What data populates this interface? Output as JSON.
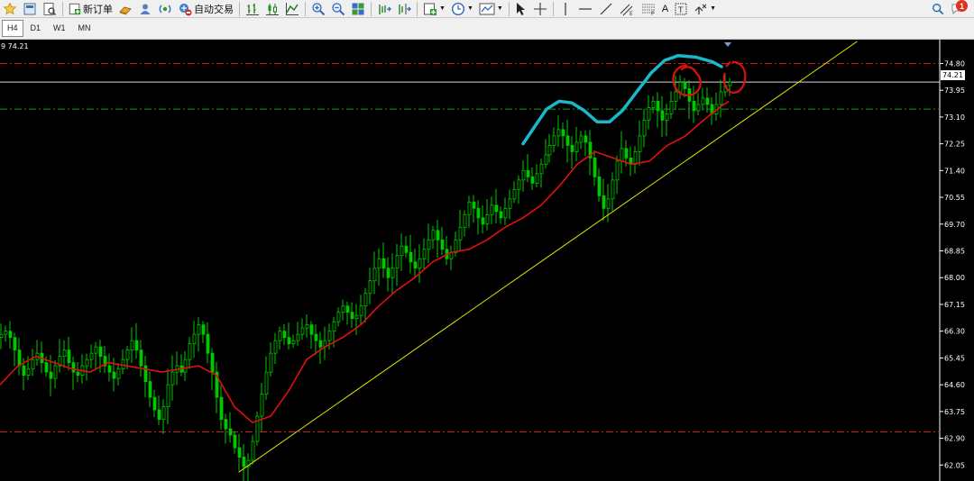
{
  "toolbar": {
    "new_order_label": "新订单",
    "auto_trade_label": "自动交易",
    "text_tool_label": "A",
    "notification_count": "1"
  },
  "timeframes": [
    {
      "label": "H4",
      "active": true
    },
    {
      "label": "D1",
      "active": false
    },
    {
      "label": "W1",
      "active": false
    },
    {
      "label": "MN",
      "active": false
    }
  ],
  "chart": {
    "info_text": "9 74.21",
    "current_price": "74.21",
    "colors": {
      "up_candle": "#00c800",
      "ma_line": "#e01010",
      "trendline": "#e6e600",
      "resistance": "#cc2020",
      "support": "#10a010",
      "annotation_curve": "#1ab8c8",
      "annotation_circles": "#dd1010"
    }
  },
  "chart_data": {
    "type": "candlestick",
    "y_ticks": [
      "74.80",
      "73.95",
      "73.10",
      "72.25",
      "71.40",
      "70.55",
      "69.70",
      "68.85",
      "68.00",
      "67.15",
      "66.30",
      "65.45",
      "64.60",
      "63.75",
      "62.90",
      "62.05"
    ],
    "ylim": [
      61.6,
      75.5
    ],
    "current_price": 74.21,
    "horizontal_levels": [
      {
        "price": 74.8,
        "style": "dash-dot",
        "color": "red"
      },
      {
        "price": 73.35,
        "style": "dash-dot",
        "color": "green"
      },
      {
        "price": 63.1,
        "style": "dash-dot",
        "color": "red"
      }
    ],
    "trendline": {
      "start": {
        "bar": 0.245,
        "price": 61.82
      },
      "end": {
        "bar": 0.88,
        "price": 75.5
      }
    },
    "closes": [
      66.2,
      66.3,
      66.1,
      65.7,
      65.2,
      64.9,
      65.1,
      65.4,
      65.6,
      65.3,
      65.0,
      64.8,
      65.2,
      65.5,
      65.7,
      65.3,
      65.0,
      64.9,
      65.2,
      65.4,
      65.6,
      65.8,
      65.5,
      65.2,
      65.0,
      64.8,
      65.1,
      65.4,
      65.7,
      66.0,
      65.7,
      65.2,
      64.7,
      64.2,
      63.8,
      63.5,
      63.9,
      64.6,
      65.0,
      65.2,
      65.0,
      65.4,
      65.9,
      66.2,
      66.5,
      66.2,
      65.6,
      65.0,
      64.2,
      63.5,
      63.2,
      63.0,
      62.6,
      62.3,
      62.0,
      62.2,
      62.8,
      63.6,
      64.3,
      65.0,
      65.6,
      66.0,
      66.3,
      66.1,
      65.9,
      66.0,
      66.2,
      66.4,
      66.5,
      66.2,
      66.0,
      65.8,
      66.0,
      66.3,
      66.6,
      66.9,
      67.1,
      66.9,
      66.7,
      66.8,
      67.1,
      67.5,
      67.9,
      68.3,
      68.6,
      68.3,
      68.0,
      68.3,
      68.7,
      69.0,
      68.8,
      68.5,
      68.3,
      68.6,
      68.9,
      69.2,
      69.5,
      69.2,
      68.9,
      68.6,
      68.8,
      69.2,
      69.6,
      70.0,
      70.4,
      70.2,
      69.9,
      69.7,
      70.0,
      70.3,
      70.1,
      69.9,
      70.2,
      70.5,
      70.8,
      71.1,
      71.4,
      71.2,
      71.0,
      71.3,
      71.6,
      71.9,
      72.2,
      72.5,
      72.7,
      72.5,
      72.2,
      72.0,
      72.3,
      72.5,
      72.3,
      71.8,
      71.2,
      70.6,
      70.2,
      70.5,
      71.1,
      71.7,
      72.1,
      71.8,
      71.6,
      72.0,
      72.5,
      73.0,
      73.4,
      73.6,
      73.3,
      73.0,
      73.2,
      73.6,
      73.9,
      74.2,
      74.0,
      73.6,
      73.3,
      73.5,
      73.7,
      73.5,
      73.2,
      73.5,
      73.9,
      74.1,
      74.21
    ],
    "ma_points": [
      [
        0,
        64.6
      ],
      [
        20,
        65.2
      ],
      [
        40,
        65.5
      ],
      [
        60,
        65.3
      ],
      [
        80,
        65.1
      ],
      [
        100,
        65.0
      ],
      [
        120,
        65.3
      ],
      [
        140,
        65.2
      ],
      [
        160,
        65.1
      ],
      [
        180,
        65.0
      ],
      [
        200,
        65.1
      ],
      [
        220,
        65.2
      ],
      [
        240,
        64.9
      ],
      [
        260,
        63.9
      ],
      [
        280,
        63.4
      ],
      [
        300,
        63.6
      ],
      [
        320,
        64.4
      ],
      [
        340,
        65.4
      ],
      [
        360,
        65.8
      ],
      [
        380,
        66.1
      ],
      [
        400,
        66.5
      ],
      [
        420,
        67.1
      ],
      [
        440,
        67.6
      ],
      [
        460,
        68.0
      ],
      [
        480,
        68.5
      ],
      [
        500,
        68.8
      ],
      [
        520,
        68.9
      ],
      [
        540,
        69.2
      ],
      [
        560,
        69.6
      ],
      [
        580,
        69.9
      ],
      [
        600,
        70.3
      ],
      [
        620,
        70.9
      ],
      [
        640,
        71.6
      ],
      [
        660,
        72.0
      ],
      [
        680,
        71.8
      ],
      [
        700,
        71.6
      ],
      [
        720,
        71.7
      ],
      [
        740,
        72.2
      ],
      [
        760,
        72.5
      ],
      [
        780,
        73.0
      ],
      [
        800,
        73.45
      ],
      [
        808,
        73.6
      ]
    ],
    "annotation_curve_points": [
      [
        580,
        72.25
      ],
      [
        593,
        72.8
      ],
      [
        606,
        73.35
      ],
      [
        620,
        73.6
      ],
      [
        634,
        73.55
      ],
      [
        648,
        73.3
      ],
      [
        662,
        72.95
      ],
      [
        676,
        72.95
      ],
      [
        690,
        73.3
      ],
      [
        706,
        73.9
      ],
      [
        722,
        74.5
      ],
      [
        737,
        74.9
      ],
      [
        752,
        75.05
      ],
      [
        772,
        75.0
      ],
      [
        790,
        74.85
      ],
      [
        800,
        74.7
      ]
    ]
  }
}
